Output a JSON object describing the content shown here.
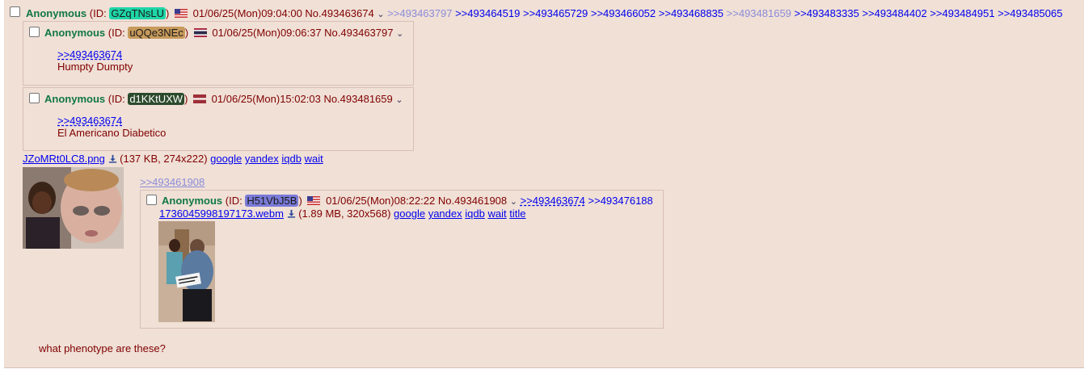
{
  "op": {
    "name": "Anonymous",
    "id_prefix": "(ID: ",
    "id": "GZqTNsLU",
    "id_suffix": ")",
    "datetime": "01/06/25(Mon)09:04:00",
    "no": "No.493463674",
    "backlinks_faded_1": ">>493463797",
    "backlinks_1": ">>493464519",
    "backlinks_2": ">>493465729",
    "backlinks_3": ">>493466052",
    "backlinks_4": ">>493468835",
    "backlinks_faded_2": ">>493481659",
    "backlinks_5": ">>493483335",
    "backlinks_6": ">>493484402",
    "backlinks_7": ">>493484951",
    "backlinks_8": ">>493485065",
    "file": {
      "name": "JZoMRt0LC8.png",
      "meta": "(137 KB, 274x222)",
      "google": "google",
      "yandex": "yandex",
      "iqdb": "iqdb",
      "wait": "wait"
    },
    "quote_ref": ">>493461908",
    "comment": "what phenotype are these?"
  },
  "reply1": {
    "name": "Anonymous",
    "id_prefix": "(ID: ",
    "id": "uQQe3NEc",
    "id_suffix": ")",
    "datetime": "01/06/25(Mon)09:06:37",
    "no": "No.493463797",
    "quote": ">>493463674",
    "text": "Humpty Dumpty"
  },
  "reply2": {
    "name": "Anonymous",
    "id_prefix": "(ID: ",
    "id": "d1KKtUXW",
    "id_suffix": ")",
    "datetime": "01/06/25(Mon)15:02:03",
    "no": "No.493481659",
    "quote": ">>493463674",
    "text": "El Americano Diabetico"
  },
  "inline": {
    "name": "Anonymous",
    "id_prefix": "(ID: ",
    "id": "H51VbJ5B",
    "id_suffix": ")",
    "datetime": "01/06/25(Mon)08:22:22",
    "no": "No.493461908",
    "backlink_1": ">>493463674",
    "backlink_2": ">>493476188",
    "file": {
      "name": "1736045998197173.webm",
      "meta": "(1.89 MB, 320x568)",
      "google": "google",
      "yandex": "yandex",
      "iqdb": "iqdb",
      "wait": "wait",
      "title": "title"
    }
  },
  "colors": {
    "op_id": "#1ed6a8",
    "reply1_id": "#c79a5b",
    "reply2_id": "#2c4a2c",
    "inline_id": "#7a7ad8"
  },
  "icons": {
    "chevron": "chevron-down-icon",
    "download": "download-icon",
    "flag_us": "us-flag-icon",
    "flag_th": "thailand-flag-icon",
    "flag_lv": "latvia-flag-icon"
  }
}
